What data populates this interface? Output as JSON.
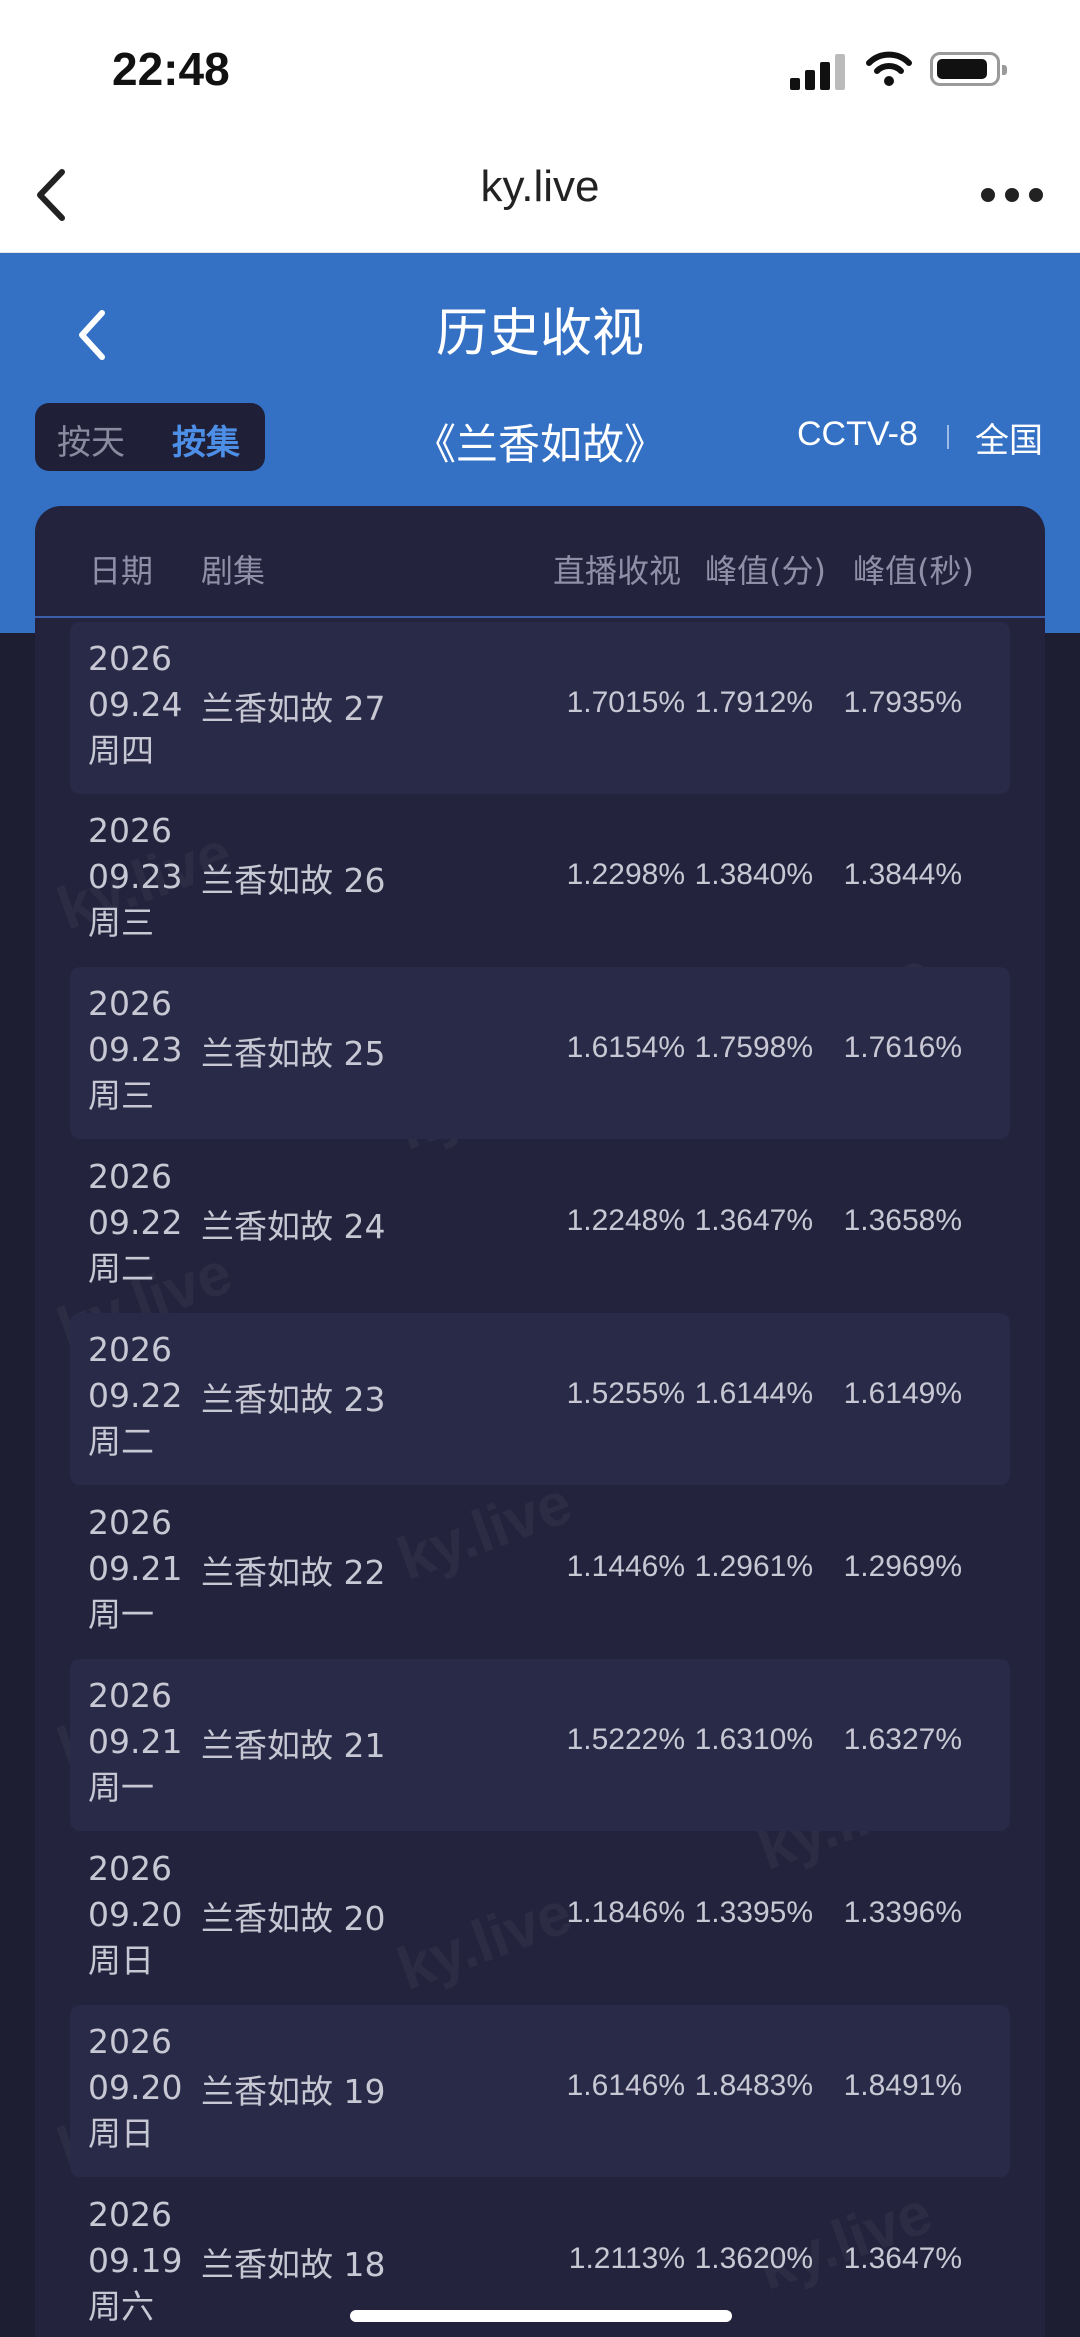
{
  "status_bar": {
    "time": "22:48"
  },
  "browser": {
    "title": "ky.live"
  },
  "header": {
    "title": "历史收视",
    "tabs": [
      {
        "label": "按天",
        "active": false
      },
      {
        "label": "按集",
        "active": true
      }
    ],
    "show_title": "《兰香如故》",
    "channel": "CCTV-8",
    "region": "全国"
  },
  "table": {
    "columns": [
      "日期",
      "剧集",
      "直播收视",
      "峰值(分)",
      "峰值(秒)"
    ],
    "rows": [
      {
        "date": "2026\n09.24\n周四",
        "episode": "兰香如故 27",
        "live": "1.7015%",
        "peak_min": "1.7912%",
        "peak_sec": "1.7935%"
      },
      {
        "date": "2026\n09.23\n周三",
        "episode": "兰香如故 26",
        "live": "1.2298%",
        "peak_min": "1.3840%",
        "peak_sec": "1.3844%"
      },
      {
        "date": "2026\n09.23\n周三",
        "episode": "兰香如故 25",
        "live": "1.6154%",
        "peak_min": "1.7598%",
        "peak_sec": "1.7616%"
      },
      {
        "date": "2026\n09.22\n周二",
        "episode": "兰香如故 24",
        "live": "1.2248%",
        "peak_min": "1.3647%",
        "peak_sec": "1.3658%"
      },
      {
        "date": "2026\n09.22\n周二",
        "episode": "兰香如故 23",
        "live": "1.5255%",
        "peak_min": "1.6144%",
        "peak_sec": "1.6149%"
      },
      {
        "date": "2026\n09.21\n周一",
        "episode": "兰香如故 22",
        "live": "1.1446%",
        "peak_min": "1.2961%",
        "peak_sec": "1.2969%"
      },
      {
        "date": "2026\n09.21\n周一",
        "episode": "兰香如故 21",
        "live": "1.5222%",
        "peak_min": "1.6310%",
        "peak_sec": "1.6327%"
      },
      {
        "date": "2026\n09.20\n周日",
        "episode": "兰香如故 20",
        "live": "1.1846%",
        "peak_min": "1.3395%",
        "peak_sec": "1.3396%"
      },
      {
        "date": "2026\n09.20\n周日",
        "episode": "兰香如故 19",
        "live": "1.6146%",
        "peak_min": "1.8483%",
        "peak_sec": "1.8491%"
      },
      {
        "date": "2026\n09.19\n周六",
        "episode": "兰香如故 18",
        "live": "1.2113%",
        "peak_min": "1.3620%",
        "peak_sec": "1.3647%"
      }
    ]
  },
  "watermark": "ky.live",
  "colors": {
    "header_blue": "#3471c4",
    "page_bg": "#1e1e33",
    "card_bg": "#23233d",
    "active_tab": "#4d8fe6"
  }
}
